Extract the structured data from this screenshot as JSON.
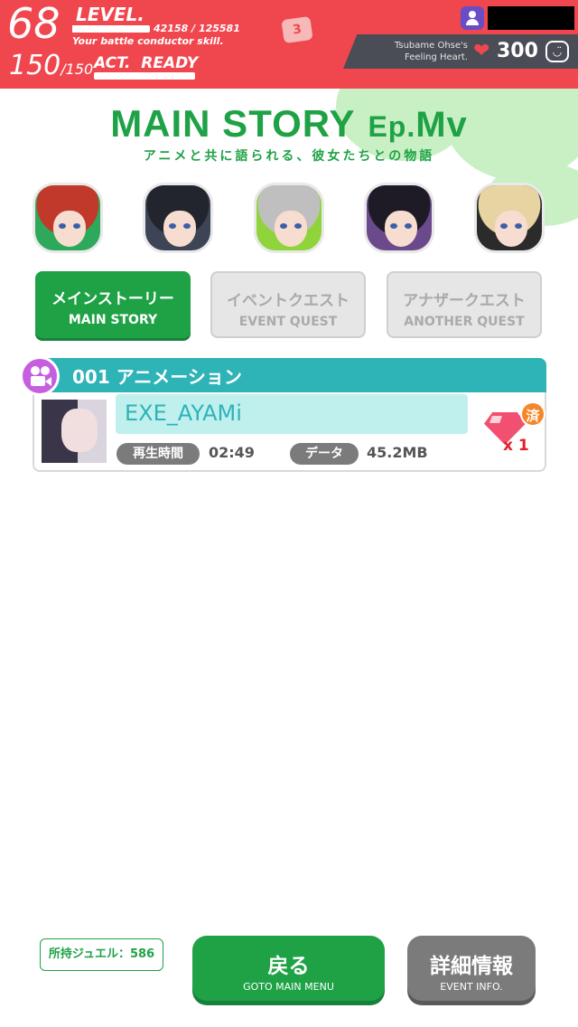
{
  "header": {
    "level": "68",
    "level_label": "LEVEL.",
    "exp_text": "42158 / 125581",
    "exp_fraction": 0.336,
    "skill_text": "Your battle conductor skill.",
    "act_value": "150",
    "act_max": "/150",
    "act_label": "ACT.",
    "act_status": "READY",
    "ribbon_text": "3",
    "heart_caption_line1": "Tsubame Ohse's",
    "heart_caption_line2": "Feeling Heart.",
    "heart_count": "300",
    "heart_icon": "heart-icon",
    "profile_icon": "user-icon",
    "face_icon": "face-icon",
    "face_glyph": "◡̈"
  },
  "page": {
    "title_main": "MAIN STORY",
    "title_ep": "Ep.",
    "title_mv": "Mv",
    "subtitle": "アニメと共に語られる、彼女たちとの物語",
    "accent_color": "#1fa246"
  },
  "portraits": [
    {
      "name": "portrait-1",
      "hair": "#c0392b",
      "bg": "#2ea85b"
    },
    {
      "name": "portrait-2",
      "hair": "#22252e",
      "bg": "#3d4455"
    },
    {
      "name": "portrait-3",
      "hair": "#bfbfbf",
      "bg": "#8fd43a"
    },
    {
      "name": "portrait-4",
      "hair": "#1f1b26",
      "bg": "#6b4a8b"
    },
    {
      "name": "portrait-5",
      "hair": "#e8d3a3",
      "bg": "#2b2b2b"
    }
  ],
  "tabs": [
    {
      "jp": "メインストーリー",
      "en": "MAIN STORY",
      "active": true
    },
    {
      "jp": "イベントクエスト",
      "en": "EVENT QUEST",
      "active": false
    },
    {
      "jp": "アナザークエスト",
      "en": "ANOTHER QUEST",
      "active": false
    }
  ],
  "story": {
    "header": "001 アニメーション",
    "name": "EXE_AYAMi",
    "play_time_label": "再生時間",
    "play_time": "02:49",
    "data_label": "データ",
    "data_size": "45.2MB",
    "used_badge": "済",
    "reward_count": "x 1",
    "header_color": "#2eb3b7"
  },
  "footer": {
    "jewel_label": "所持ジュエル：586",
    "back_jp": "戻る",
    "back_en": "GOTO MAIN MENU",
    "info_jp": "詳細情報",
    "info_en": "EVENT INFO."
  }
}
